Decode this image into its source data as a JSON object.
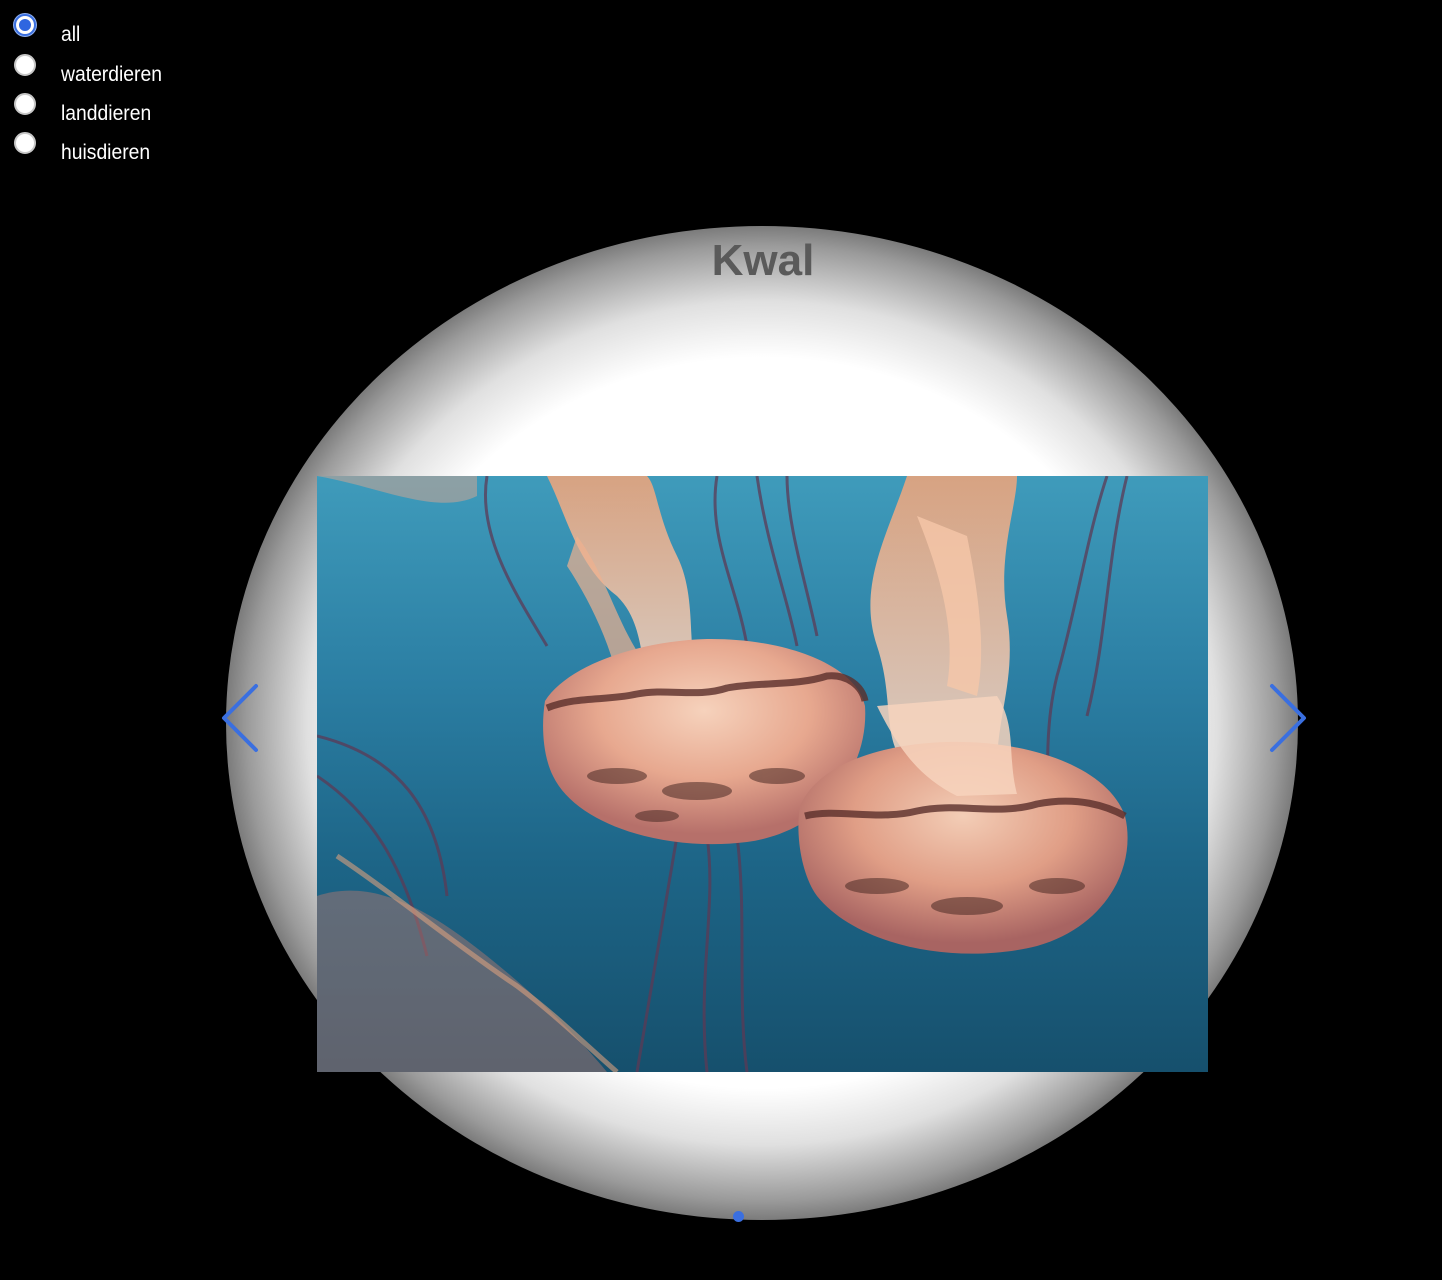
{
  "filters": {
    "options": [
      {
        "label": "all",
        "checked": true
      },
      {
        "label": "waterdieren",
        "checked": false
      },
      {
        "label": "landdieren",
        "checked": false
      },
      {
        "label": "huisdieren",
        "checked": false
      }
    ]
  },
  "slider": {
    "title": "Kwal",
    "image_alt": "jellyfish-photo",
    "prev_icon": "chevron-left-icon",
    "next_icon": "chevron-right-icon",
    "accent_color": "#3a6fe0",
    "title_color": "#5a5a5a",
    "dots_count": 1,
    "active_dot": 1
  }
}
